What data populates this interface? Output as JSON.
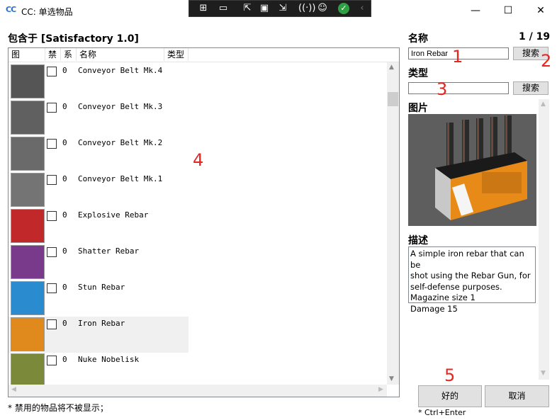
{
  "window": {
    "icon_text": "CC",
    "title": "CC: 单选物品",
    "minimize_glyph": "—",
    "maximize_glyph": "☐",
    "close_glyph": "✕"
  },
  "left_panel": {
    "contains_label": "包含于 [Satisfactory 1.0]",
    "columns": [
      "图",
      "禁",
      "系",
      "名称",
      "类型"
    ],
    "rows": [
      {
        "count": "0",
        "name": "Conveyor Belt Mk.4",
        "thumb_color": "#555555"
      },
      {
        "count": "0",
        "name": "Conveyor Belt Mk.3",
        "thumb_color": "#606060"
      },
      {
        "count": "0",
        "name": "Conveyor Belt Mk.2",
        "thumb_color": "#6a6a6a"
      },
      {
        "count": "0",
        "name": "Conveyor Belt Mk.1",
        "thumb_color": "#747474"
      },
      {
        "count": "0",
        "name": "Explosive Rebar",
        "thumb_color": "#c0282a"
      },
      {
        "count": "0",
        "name": "Shatter Rebar",
        "thumb_color": "#7a3a8c"
      },
      {
        "count": "0",
        "name": "Stun Rebar",
        "thumb_color": "#2a8ccf"
      },
      {
        "count": "0",
        "name": "Iron Rebar",
        "thumb_color": "#e08a1e"
      },
      {
        "count": "0",
        "name": "Nuke Nobelisk",
        "thumb_color": "#7a8a3a"
      }
    ],
    "footnote": "* 禁用的物品将不被显示；"
  },
  "right_panel": {
    "name_label": "名称",
    "page_indicator": "1 / 19",
    "name_value": "Iron Rebar",
    "search_button": "搜索",
    "type_label": "类型",
    "type_value": "",
    "search_button_2": "搜索",
    "picture_label": "图片",
    "desc_label": "描述",
    "description_lines": [
      "A simple iron rebar that can be",
      "shot using the Rebar Gun, for",
      "self-defense purposes.",
      "Magazine size 1",
      "Damage 15"
    ],
    "ok_button": "好的",
    "cancel_button": "取消",
    "shortcut_hint": "* Ctrl+Enter"
  },
  "annotations": [
    "1",
    "2",
    "3",
    "4",
    "5"
  ],
  "colors": {
    "annotation": "#e8261f",
    "selected_row": "#f0f0f0",
    "checkmark_green": "#2ea043"
  }
}
